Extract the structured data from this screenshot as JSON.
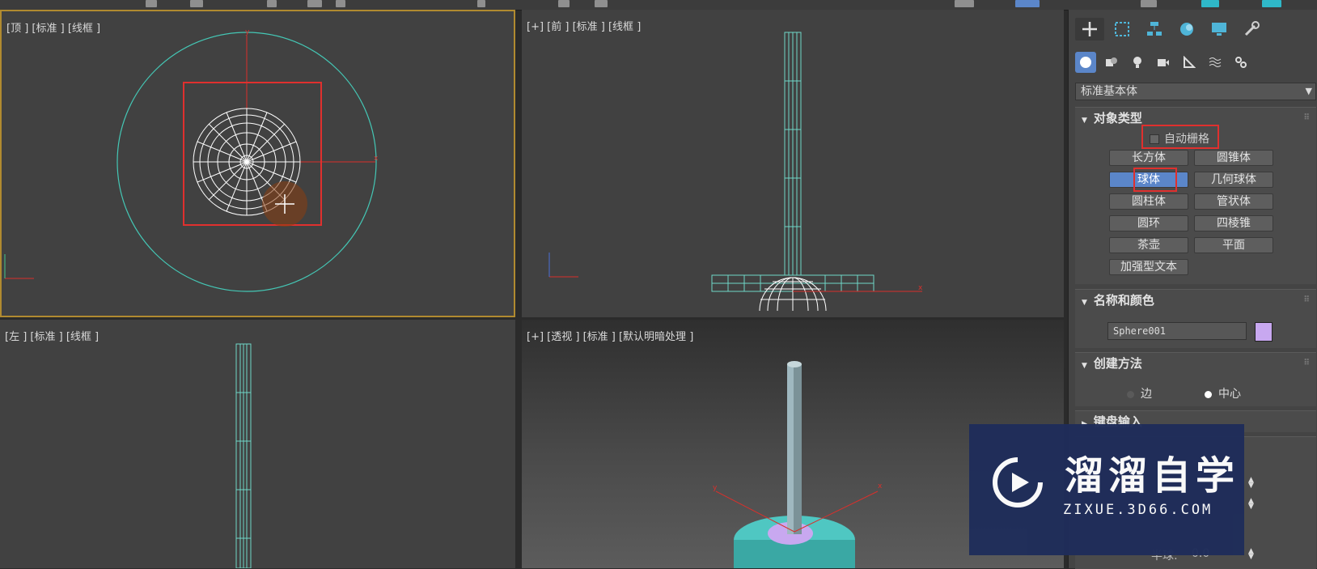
{
  "viewports": {
    "top": {
      "label": "[顶 ] [标准 ] [线框 ]"
    },
    "front": {
      "label": "[+] [前 ] [标准 ] [线框 ]"
    },
    "left": {
      "label": "[左 ] [标准 ] [线框 ]"
    },
    "perspective": {
      "label": "[+] [透视 ] [标准 ] [默认明暗处理 ]"
    }
  },
  "command_panel": {
    "tabs": [
      "create-icon",
      "modify-icon",
      "hierarchy-icon",
      "motion-icon",
      "display-icon",
      "utilities-icon"
    ],
    "sub_tabs": [
      "geometry-icon",
      "shapes-icon",
      "lights-icon",
      "cameras-icon",
      "helpers-icon",
      "spacewarps-icon",
      "systems-icon"
    ],
    "category": "标准基本体",
    "object_type": {
      "title": "对象类型",
      "autogrid": "自动栅格",
      "buttons": [
        "长方体",
        "圆锥体",
        "球体",
        "几何球体",
        "圆柱体",
        "管状体",
        "圆环",
        "四棱锥",
        "茶壶",
        "平面",
        "加强型文本"
      ],
      "active": "球体"
    },
    "name_color": {
      "title": "名称和颜色",
      "name": "Sphere001",
      "color": "#c8a8f0"
    },
    "creation_method": {
      "title": "创建方法",
      "options": [
        "边",
        "中心"
      ],
      "selected": "中心"
    },
    "keyboard_entry": {
      "title": "键盘输入"
    },
    "parameters": {
      "hemisphere_label": "半球:",
      "hemisphere_value": "0.0"
    }
  },
  "watermark": {
    "title": "溜溜自学",
    "subtitle": "ZIXUE.3D66.COM"
  },
  "colors": {
    "selection_red": "#e0302e",
    "active_blue": "#5b86c9",
    "wire_cyan": "#6fd6c8",
    "active_border": "#b08a30"
  }
}
